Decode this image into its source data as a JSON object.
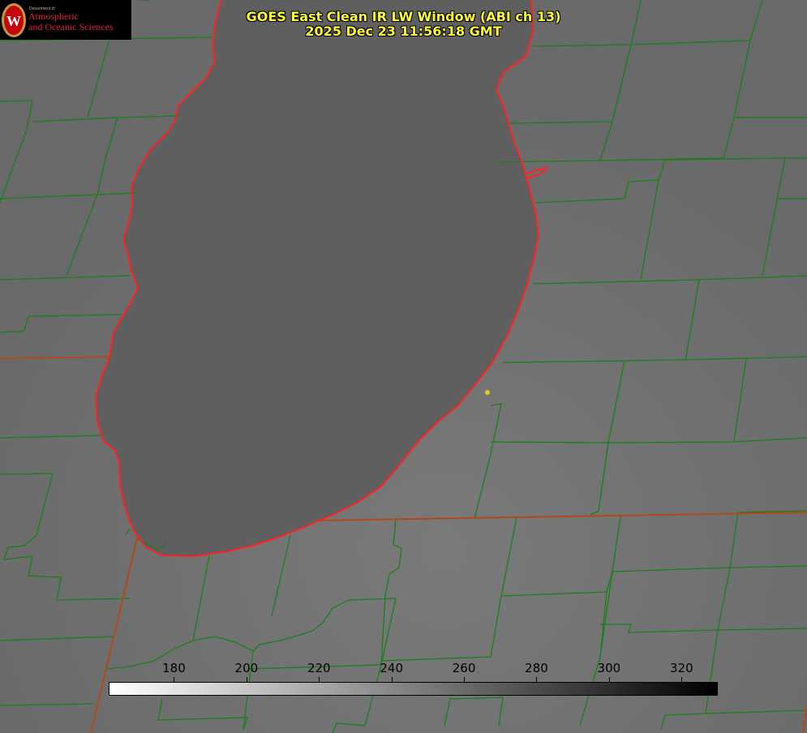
{
  "title": {
    "line1": "GOES East Clean IR LW Window (ABI ch 13)",
    "line2": "2025 Dec 23 11:56:18 GMT"
  },
  "logo": {
    "dept": "Department of",
    "line1": "Atmospheric",
    "line2": "and Oceanic Sciences",
    "seal_letter": "W"
  },
  "colorbar": {
    "min": 162,
    "max": 330,
    "ticks": [
      "180",
      "200",
      "220",
      "240",
      "260",
      "280",
      "300",
      "320"
    ],
    "color_low": "#ffffff",
    "color_high": "#000000"
  },
  "colors": {
    "land": "#6f6f6f",
    "lake": "#5f5f5f",
    "county_lines": "#1a7f1a",
    "shoreline": "#ff2222",
    "state_lines": "#b04a1a",
    "marker": "#d8d020",
    "title_text": "#ffff33"
  }
}
